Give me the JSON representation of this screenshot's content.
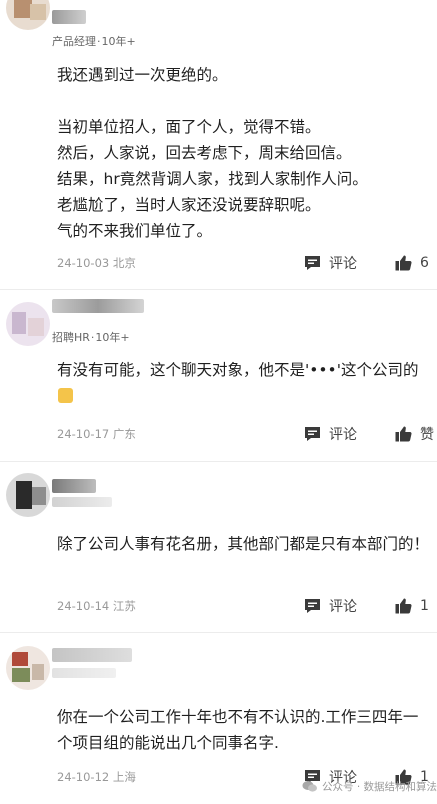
{
  "comments": [
    {
      "meta": {
        "role": "产品经理",
        "years": "10年+"
      },
      "text": "我还遇到过一次更绝的。\n\n当初单位招人，面了个人，觉得不错。\n然后，人家说，回去考虑下，周末给回信。\n结果，hr竟然背调人家，找到人家制作人问。\n老尴尬了，当时人家还没说要辞职呢。\n气的不来我们单位了。",
      "date": "24-10-03 北京",
      "reply_label": "评论",
      "like_label": "6"
    },
    {
      "meta": {
        "role": "招聘HR",
        "years": "10年+"
      },
      "text": "有没有可能，这个聊天对象，他不是'•••'这个公司的",
      "date": "24-10-17 广东",
      "reply_label": "评论",
      "like_label": "赞"
    },
    {
      "meta": {
        "role": "",
        "years": ""
      },
      "text": "除了公司人事有花名册，其他部门都是只有本部门的！",
      "date": "24-10-14 江苏",
      "reply_label": "评论",
      "like_label": "1"
    },
    {
      "meta": {
        "role": "",
        "years": ""
      },
      "text": "你在一个公司工作十年也不有不认识的.工作三四年一个项目组的能说出几个同事名字.",
      "date": "24-10-12 上海",
      "reply_label": "评论",
      "like_label": "1"
    }
  ],
  "watermark": {
    "text": "公众号 · 数据结构和算法"
  },
  "colors": {
    "icon": "#3a3a3a",
    "date": "#999999",
    "text": "#1f1f1f"
  },
  "icons": {
    "reply": "comment-icon",
    "like": "thumbs-up-icon"
  }
}
